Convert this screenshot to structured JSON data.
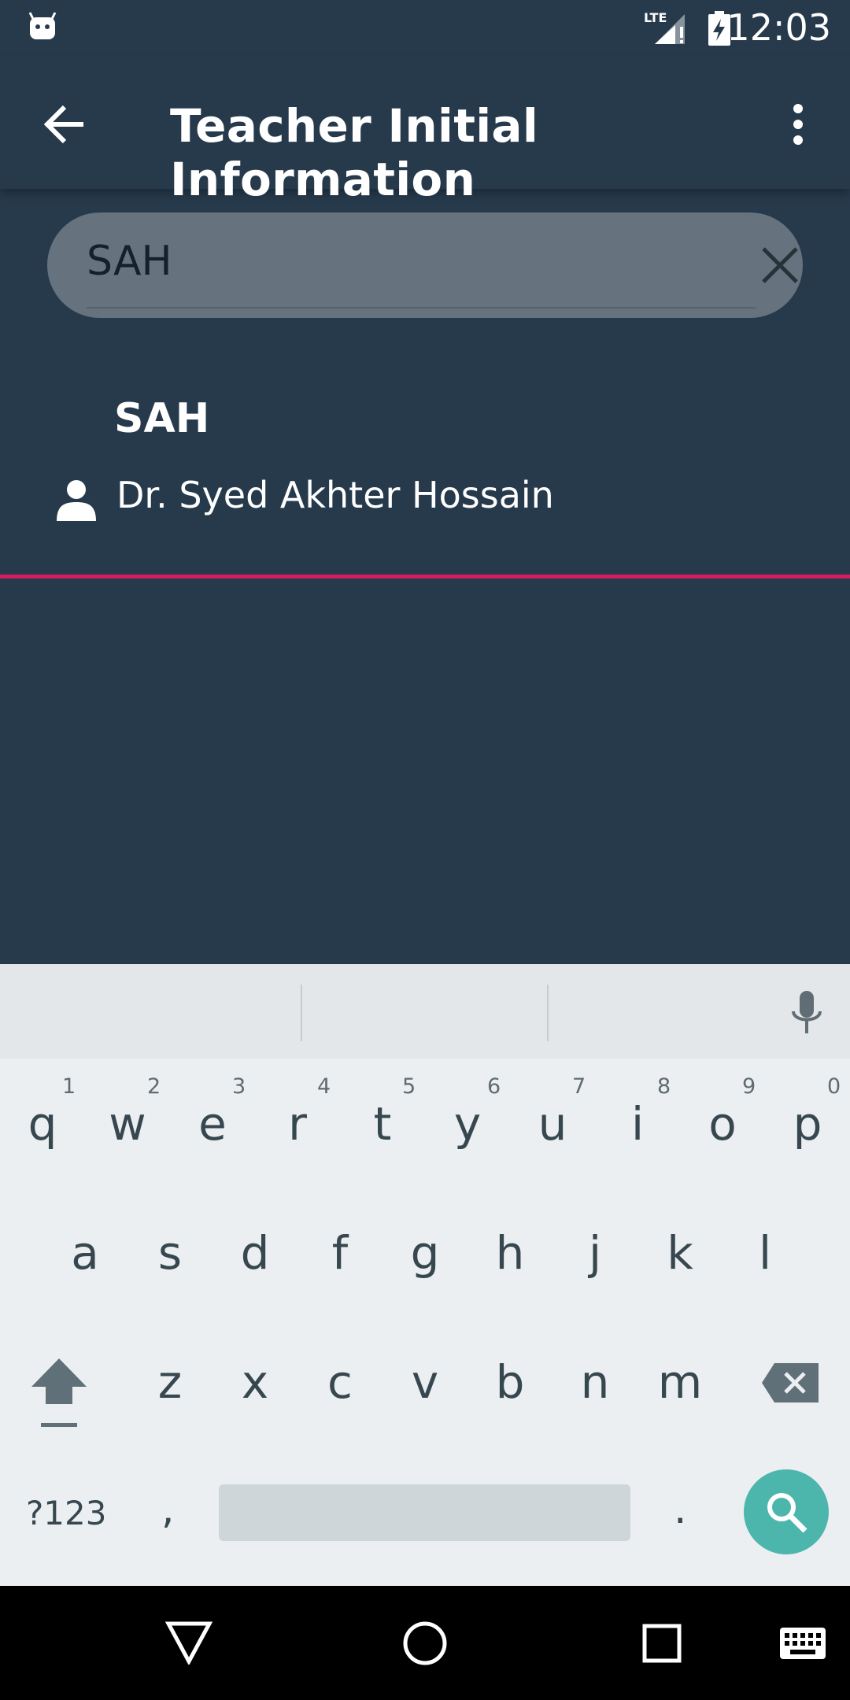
{
  "status_bar": {
    "time": "12:03",
    "network": "LTE",
    "icons": [
      "android-debug-icon",
      "lte-signal-icon",
      "battery-charging-icon"
    ]
  },
  "app_bar": {
    "title": "Teacher Initial Information",
    "icons": [
      "back-arrow-icon",
      "more-vert-icon"
    ]
  },
  "search": {
    "value": "SAH",
    "clear_icon": "close-icon"
  },
  "results": [
    {
      "initial": "SAH",
      "name": "Dr. Syed Akhter Hossain",
      "icon": "person-icon"
    }
  ],
  "colors": {
    "background": "#263a4c",
    "divider_accent": "#d81b60",
    "search_field": "#66737e",
    "keyboard_action": "#4db6ac"
  },
  "keyboard": {
    "row1": [
      {
        "key": "q",
        "hint": "1"
      },
      {
        "key": "w",
        "hint": "2"
      },
      {
        "key": "e",
        "hint": "3"
      },
      {
        "key": "r",
        "hint": "4"
      },
      {
        "key": "t",
        "hint": "5"
      },
      {
        "key": "y",
        "hint": "6"
      },
      {
        "key": "u",
        "hint": "7"
      },
      {
        "key": "i",
        "hint": "8"
      },
      {
        "key": "o",
        "hint": "9"
      },
      {
        "key": "p",
        "hint": "0"
      }
    ],
    "row2": [
      "a",
      "s",
      "d",
      "f",
      "g",
      "h",
      "j",
      "k",
      "l"
    ],
    "row3": [
      "z",
      "x",
      "c",
      "v",
      "b",
      "n",
      "m"
    ],
    "symbols_label": "?123",
    "comma": ",",
    "period": ".",
    "icons": [
      "mic-icon",
      "shift-icon",
      "backspace-icon",
      "search-icon"
    ]
  },
  "nav_bar": {
    "icons": [
      "back-triangle-icon",
      "home-circle-icon",
      "recents-square-icon",
      "keyboard-switch-icon"
    ]
  }
}
